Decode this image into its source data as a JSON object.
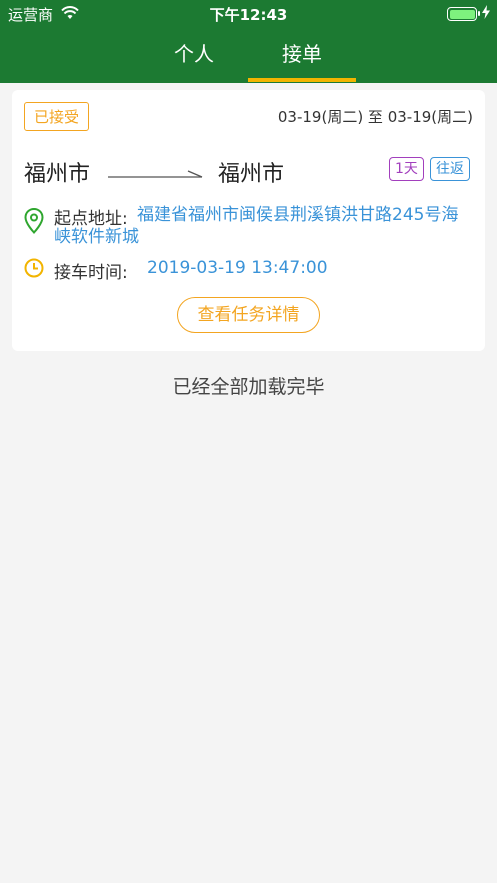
{
  "status_bar": {
    "carrier": "运营商",
    "time": "下午12:43"
  },
  "tabs": [
    {
      "label": "个人"
    },
    {
      "label": "接单"
    }
  ],
  "colors": {
    "header": "#1c7a32",
    "tab_indicator": "#f2b400",
    "accent_orange": "#f3a521",
    "link_blue": "#3a93d8",
    "tag_purple": "#a23fbd"
  },
  "order": {
    "status": "已接受",
    "date_range": "03-19(周二) 至 03-19(周二)",
    "from_city": "福州市",
    "to_city": "福州市",
    "tag_days": "1天",
    "tag_type": "往返",
    "address_label": "起点地址:",
    "address_value": "福建省福州市闽侯县荆溪镇洪甘路245号海峡软件新城",
    "time_label": "接车时间:",
    "time_value": "2019-03-19 13:47:00",
    "detail_button": "查看任务详情"
  },
  "footer": {
    "load_complete": "已经全部加载完毕"
  },
  "icons": [
    "wifi-icon",
    "battery-icon",
    "charging-icon",
    "arrow-icon",
    "location-pin-icon",
    "clock-icon"
  ]
}
